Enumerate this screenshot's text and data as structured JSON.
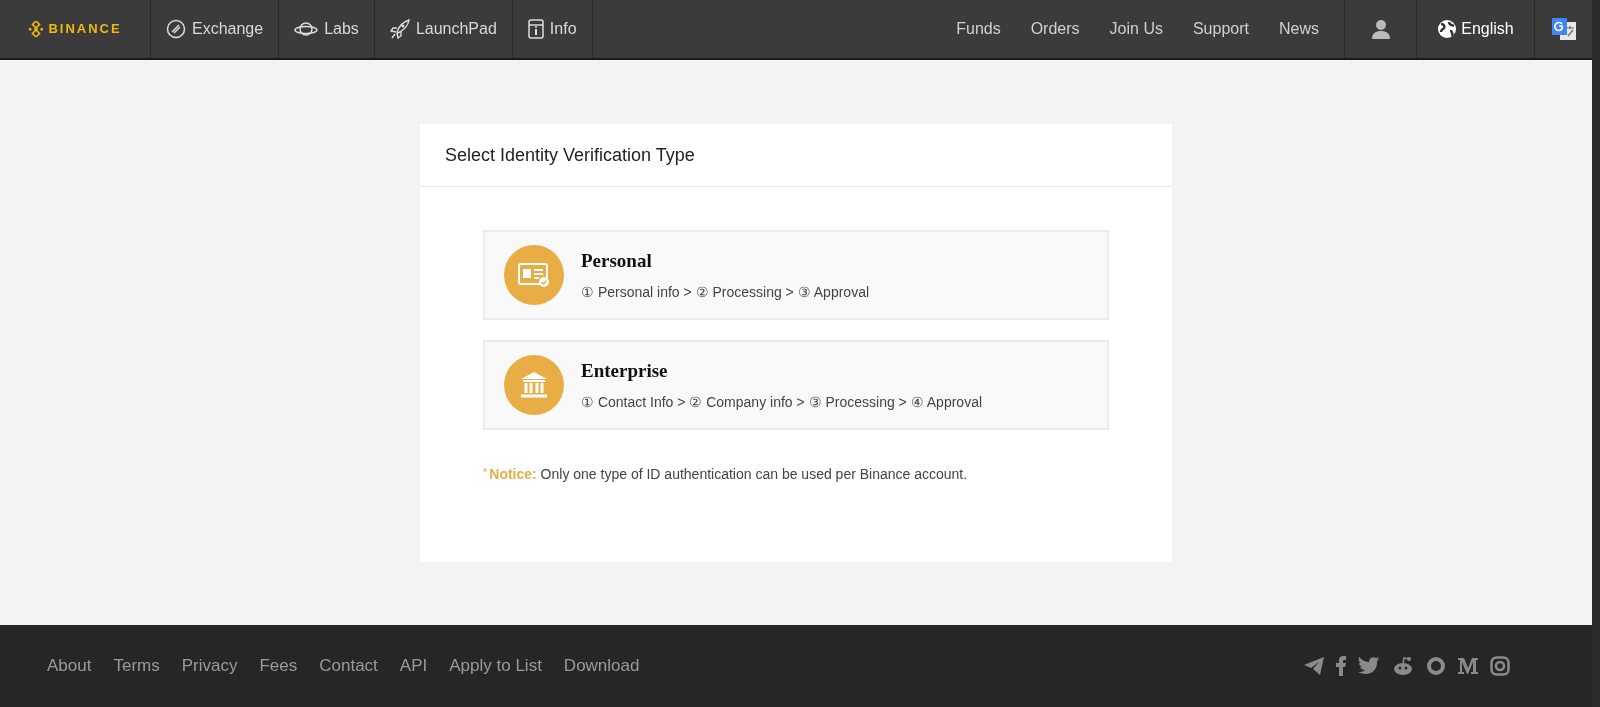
{
  "nav": {
    "logo": "BINANCE",
    "left": [
      {
        "label": "Exchange",
        "kind": "exchange"
      },
      {
        "label": "Labs",
        "kind": "labs"
      },
      {
        "label": "LaunchPad",
        "kind": "launchpad"
      },
      {
        "label": "Info",
        "kind": "info"
      }
    ],
    "right": [
      "Funds",
      "Orders",
      "Join Us",
      "Support",
      "News"
    ],
    "language": "English"
  },
  "card": {
    "title": "Select Identity Verification Type",
    "options": [
      {
        "kind": "personal",
        "title": "Personal",
        "steps": "① Personal info > ② Processing > ③ Approval"
      },
      {
        "kind": "enterprise",
        "title": "Enterprise",
        "steps": "① Contact Info > ② Company info > ③ Processing > ④ Approval"
      }
    ],
    "notice": {
      "marker": "*",
      "label": "Notice:",
      "text": "Only one type of ID authentication can be used per Binance account."
    }
  },
  "footer": {
    "links": [
      "About",
      "Terms",
      "Privacy",
      "Fees",
      "Contact",
      "API",
      "Apply to List",
      "Download"
    ]
  }
}
